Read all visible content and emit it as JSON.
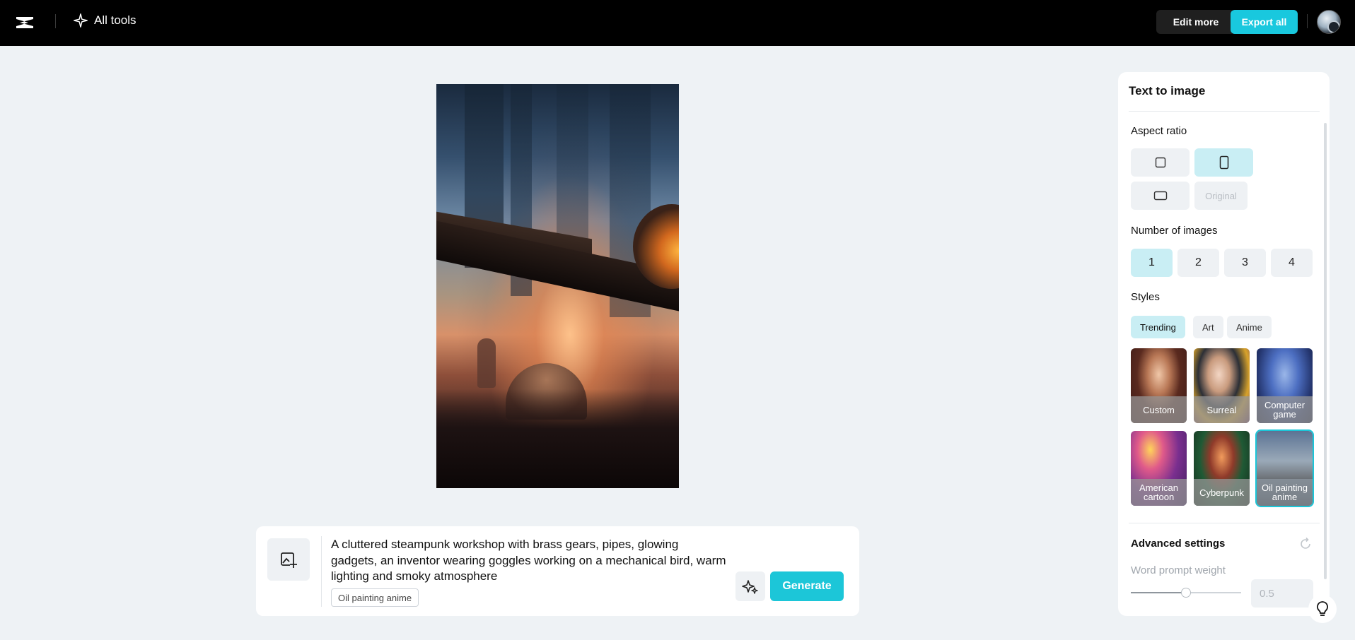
{
  "topbar": {
    "logo_icon": "capcut-logo-icon",
    "all_tools_label": "All tools",
    "edit_more_label": "Edit more",
    "export_all_label": "Export all"
  },
  "prompt": {
    "text": "A cluttered steampunk workshop with brass gears, pipes, glowing gadgets, an inventor wearing goggles working on a mechanical bird, warm lighting and smoky atmosphere",
    "style_chip": "Oil painting anime",
    "generate_label": "Generate"
  },
  "panel": {
    "title": "Text to image",
    "aspect_ratio_label": "Aspect ratio",
    "aspect_original_label": "Original",
    "aspect_selected": "portrait",
    "number_of_images_label": "Number of images",
    "numbers": [
      "1",
      "2",
      "3",
      "4"
    ],
    "number_selected": "1",
    "styles_label": "Styles",
    "style_tabs": [
      "Trending",
      "Art",
      "Anime"
    ],
    "style_tab_selected": "Trending",
    "style_cards": [
      "Custom",
      "Surreal",
      "Computer game",
      "American cartoon",
      "Cyberpunk",
      "Oil painting anime"
    ],
    "style_card_selected": "Oil painting anime",
    "advanced_settings_label": "Advanced settings",
    "word_prompt_weight_label": "Word prompt weight",
    "word_prompt_weight_value": "0.5",
    "word_prompt_weight_fraction": 0.5
  },
  "colors": {
    "accent": "#1cc6d8",
    "selected_bg": "#c9eef4",
    "topbar_bg": "#000000",
    "page_bg": "#eef2f5"
  }
}
